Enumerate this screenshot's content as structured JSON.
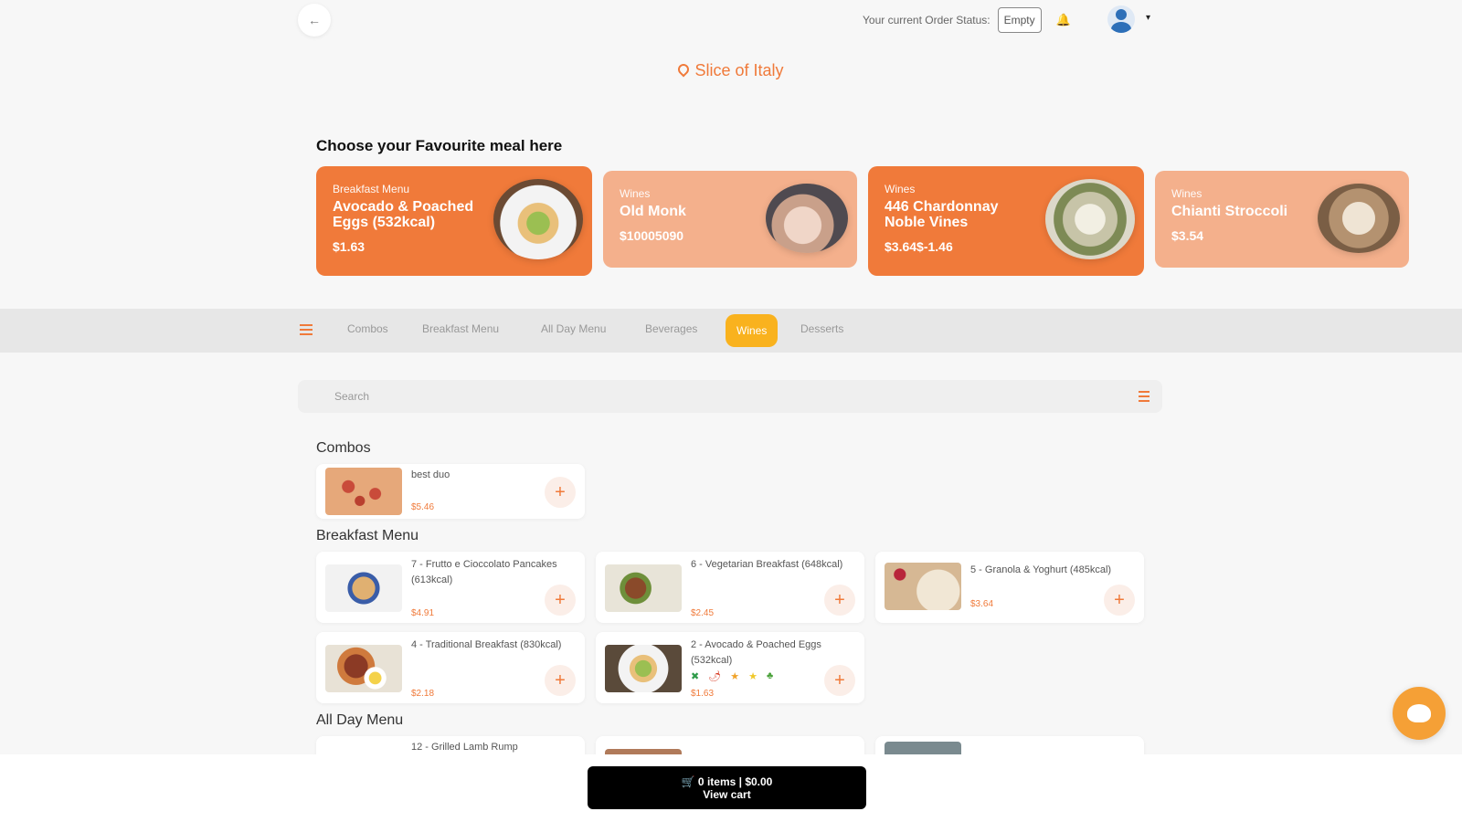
{
  "header": {
    "back_glyph": "←",
    "status_label": "Your current Order Status:",
    "status_value": "Empty",
    "bell_glyph": "🔔",
    "caret_glyph": "▾",
    "restaurant": "Slice of Italy"
  },
  "featured": {
    "heading": "Choose your Favourite meal here",
    "cards": [
      {
        "category": "Breakfast Menu",
        "name": "Avocado & Poached Eggs (532kcal)",
        "price": "$1.63",
        "active": true
      },
      {
        "category": "Wines",
        "name": "Old Monk",
        "price": "$10005090",
        "active": false
      },
      {
        "category": "Wines",
        "name": "446 Chardonnay Noble Vines",
        "price": "$3.64$-1.46",
        "active": true
      },
      {
        "category": "Wines",
        "name": "Chianti Stroccoli",
        "price": "$3.54",
        "active": false
      }
    ]
  },
  "tabs": [
    "Combos",
    "Breakfast Menu",
    "All Day Menu",
    "Beverages",
    "Wines",
    "Desserts"
  ],
  "active_tab": "Wines",
  "search": {
    "placeholder": "Search"
  },
  "groups": {
    "combos": {
      "title": "Combos",
      "items": [
        {
          "name": "best duo",
          "price": "$5.46"
        }
      ]
    },
    "breakfast": {
      "title": "Breakfast Menu",
      "items": [
        {
          "name": "7 - Frutto e Cioccolato Pancakes (613kcal)",
          "price": "$4.91"
        },
        {
          "name": "6 - Vegetarian Breakfast (648kcal)",
          "price": "$2.45"
        },
        {
          "name": "5 - Granola & Yoghurt (485kcal)",
          "price": "$3.64"
        },
        {
          "name": "4 - Traditional Breakfast (830kcal)",
          "price": "$2.18"
        },
        {
          "name": "2 - Avocado & Poached Eggs (532kcal)",
          "price": "$1.63",
          "tags": [
            "✖",
            "🌶",
            "★",
            "★",
            "♣"
          ]
        }
      ]
    },
    "allday": {
      "title": "All Day Menu",
      "items": [
        {
          "name": "12 - Grilled Lamb Rump"
        }
      ]
    }
  },
  "cart": {
    "line1": "🛒 0 items | $0.00",
    "line2": "View cart"
  },
  "add_glyph": "+",
  "colors": {
    "accent": "#f07a3a",
    "accent_light": "#f4b08c",
    "active_tab": "#f9b21e"
  }
}
